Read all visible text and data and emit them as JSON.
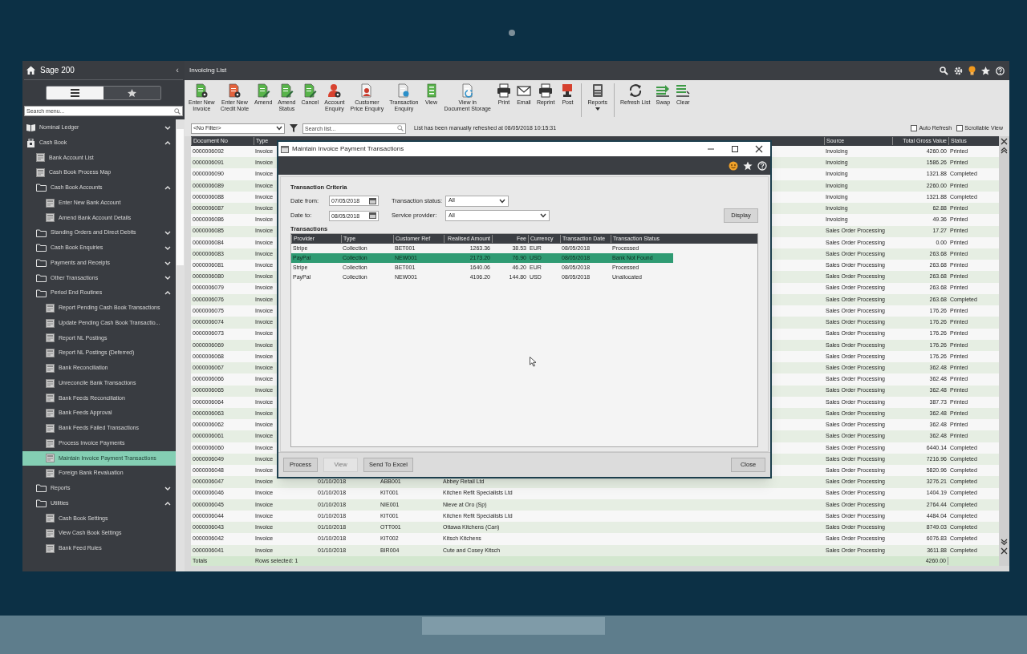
{
  "sidebar": {
    "title": "Sage 200",
    "collapse": "‹",
    "view_toggle": [
      {
        "kind": "list",
        "selected": true
      },
      {
        "kind": "favourites",
        "selected": false
      }
    ],
    "search": {
      "placeholder": "Search menu..."
    },
    "tree": [
      {
        "label": "Nominal Ledger",
        "kind": "module",
        "expanded": false,
        "selected": false
      },
      {
        "label": "Cash Book",
        "kind": "module",
        "expanded": true,
        "selected": false,
        "children": [
          {
            "label": "Bank Account List",
            "kind": "screen",
            "selected": false
          },
          {
            "label": "Cash Book Process Map",
            "kind": "screen",
            "selected": false
          },
          {
            "label": "Cash Book Accounts",
            "kind": "folder",
            "expanded": true,
            "selected": false,
            "children": [
              {
                "label": "Enter New Bank Account",
                "kind": "screen",
                "selected": false
              },
              {
                "label": "Amend Bank Account Details",
                "kind": "screen",
                "selected": false
              }
            ]
          },
          {
            "label": "Standing Orders and Direct Debits",
            "kind": "folder",
            "expanded": false,
            "selected": false
          },
          {
            "label": "Cash Book Enquiries",
            "kind": "folder",
            "expanded": false,
            "selected": false
          },
          {
            "label": "Payments and Receipts",
            "kind": "folder",
            "expanded": false,
            "selected": false
          },
          {
            "label": "Other Transactions",
            "kind": "folder",
            "expanded": false,
            "selected": false
          },
          {
            "label": "Period End Routines",
            "kind": "folder",
            "expanded": true,
            "selected": false,
            "children": [
              {
                "label": "Report Pending Cash Book Transactions",
                "kind": "screen",
                "selected": false
              },
              {
                "label": "Update Pending Cash Book Transactio...",
                "kind": "screen",
                "selected": false
              },
              {
                "label": "Report NL Postings",
                "kind": "screen",
                "selected": false
              },
              {
                "label": "Report NL Postings (Deferred)",
                "kind": "screen",
                "selected": false
              },
              {
                "label": "Bank Reconciliation",
                "kind": "screen",
                "selected": false
              },
              {
                "label": "Unreconcile Bank Transactions",
                "kind": "screen",
                "selected": false
              },
              {
                "label": "Bank Feeds Reconciliation",
                "kind": "screen",
                "selected": false
              },
              {
                "label": "Bank Feeds Approval",
                "kind": "screen",
                "selected": false
              },
              {
                "label": "Bank Feeds Failed Transactions",
                "kind": "screen",
                "selected": false
              },
              {
                "label": "Process Invoice Payments",
                "kind": "screen",
                "selected": false
              },
              {
                "label": "Maintain Invoice Payment Transactions",
                "kind": "screen",
                "selected": true
              },
              {
                "label": "Foreign Bank Revaluation",
                "kind": "screen",
                "selected": false
              }
            ]
          },
          {
            "label": "Reports",
            "kind": "folder",
            "expanded": false,
            "selected": false
          },
          {
            "label": "Utilities",
            "kind": "folder",
            "expanded": true,
            "selected": false,
            "children": [
              {
                "label": "Cash Book Settings",
                "kind": "screen",
                "selected": false
              },
              {
                "label": "View Cash Book Settings",
                "kind": "screen",
                "selected": false
              },
              {
                "label": "Bank Feed Rules",
                "kind": "screen",
                "selected": false
              }
            ]
          }
        ]
      }
    ]
  },
  "main": {
    "title": "Invoicing List",
    "toolbar": [
      {
        "label": "Enter New\nInvoice",
        "has_menu": false,
        "separator_before": false
      },
      {
        "label": "Enter New\nCredit Note",
        "has_menu": false,
        "separator_before": false
      },
      {
        "label": "Amend",
        "has_menu": false,
        "separator_before": false
      },
      {
        "label": "Amend\nStatus",
        "has_menu": false,
        "separator_before": false
      },
      {
        "label": "Cancel",
        "has_menu": false,
        "separator_before": false
      },
      {
        "label": "Account\nEnquiry",
        "has_menu": false,
        "separator_before": false
      },
      {
        "label": "Customer\nPrice Enquiry",
        "has_menu": false,
        "separator_before": false
      },
      {
        "label": "Transaction\nEnquiry",
        "has_menu": false,
        "separator_before": false
      },
      {
        "label": "View",
        "has_menu": false,
        "separator_before": false
      },
      {
        "label": "View in\nDocument Storage",
        "has_menu": false,
        "separator_before": false
      },
      {
        "label": "Print",
        "has_menu": false,
        "separator_before": false
      },
      {
        "label": "Email",
        "has_menu": false,
        "separator_before": false
      },
      {
        "label": "Reprint",
        "has_menu": false,
        "separator_before": false
      },
      {
        "label": "Post",
        "has_menu": false,
        "separator_before": false
      },
      {
        "label": "Reports",
        "has_menu": true,
        "separator_before": true
      },
      {
        "label": "Refresh List",
        "has_menu": false,
        "separator_before": true
      },
      {
        "label": "Swap",
        "has_menu": false,
        "separator_before": false
      },
      {
        "label": "Clear",
        "has_menu": false,
        "separator_before": false
      }
    ],
    "filter": {
      "value": "<No Filter>"
    },
    "search": {
      "placeholder": "Search list..."
    },
    "refresh_note": "List has been manually refreshed at 08/05/2018 10:15:31",
    "checkboxes": [
      {
        "label": "Auto Refresh",
        "checked": false
      },
      {
        "label": "Scrollable View",
        "checked": false
      }
    ],
    "grid": {
      "columns": {
        "document_no": "Document No",
        "type": "Type",
        "source": "Source",
        "total": "Total Gross Value",
        "status": "Status"
      },
      "rows": [
        {
          "document_no": "0000006092",
          "type": "Invoice",
          "source": "Invoicing",
          "total": "4260.00",
          "status": "Printed"
        },
        {
          "document_no": "0000006091",
          "type": "Invoice",
          "source": "Invoicing",
          "total": "1586.26",
          "status": "Printed"
        },
        {
          "document_no": "0000006090",
          "type": "Invoice",
          "source": "Invoicing",
          "total": "1321.88",
          "status": "Completed"
        },
        {
          "document_no": "0000006089",
          "type": "Invoice",
          "source": "Invoicing",
          "total": "2260.00",
          "status": "Printed"
        },
        {
          "document_no": "0000006088",
          "type": "Invoice",
          "source": "Invoicing",
          "total": "1321.88",
          "status": "Completed"
        },
        {
          "document_no": "0000006087",
          "type": "Invoice",
          "source": "Invoicing",
          "total": "62.88",
          "status": "Printed"
        },
        {
          "document_no": "0000006086",
          "type": "Invoice",
          "source": "Invoicing",
          "total": "49.36",
          "status": "Printed"
        },
        {
          "document_no": "0000006085",
          "type": "Invoice",
          "source": "Sales Order Processing",
          "total": "17.27",
          "status": "Printed"
        },
        {
          "document_no": "0000006084",
          "type": "Invoice",
          "source": "Sales Order Processing",
          "total": "0.00",
          "status": "Printed"
        },
        {
          "document_no": "0000006083",
          "type": "Invoice",
          "source": "Sales Order Processing",
          "total": "263.68",
          "status": "Printed"
        },
        {
          "document_no": "0000006081",
          "type": "Invoice",
          "source": "Sales Order Processing",
          "total": "263.68",
          "status": "Printed"
        },
        {
          "document_no": "0000006080",
          "type": "Invoice",
          "source": "Sales Order Processing",
          "total": "263.68",
          "status": "Printed"
        },
        {
          "document_no": "0000006079",
          "type": "Invoice",
          "source": "Sales Order Processing",
          "total": "263.68",
          "status": "Printed"
        },
        {
          "document_no": "0000006076",
          "type": "Invoice",
          "source": "Sales Order Processing",
          "total": "263.68",
          "status": "Completed"
        },
        {
          "document_no": "0000006075",
          "type": "Invoice",
          "source": "Sales Order Processing",
          "total": "176.26",
          "status": "Printed"
        },
        {
          "document_no": "0000006074",
          "type": "Invoice",
          "source": "Sales Order Processing",
          "total": "176.26",
          "status": "Printed"
        },
        {
          "document_no": "0000006073",
          "type": "Invoice",
          "source": "Sales Order Processing",
          "total": "176.26",
          "status": "Printed"
        },
        {
          "document_no": "0000006069",
          "type": "Invoice",
          "source": "Sales Order Processing",
          "total": "176.26",
          "status": "Printed"
        },
        {
          "document_no": "0000006068",
          "type": "Invoice",
          "source": "Sales Order Processing",
          "total": "176.26",
          "status": "Printed"
        },
        {
          "document_no": "0000006067",
          "type": "Invoice",
          "source": "Sales Order Processing",
          "total": "362.48",
          "status": "Printed"
        },
        {
          "document_no": "0000006066",
          "type": "Invoice",
          "source": "Sales Order Processing",
          "total": "362.48",
          "status": "Printed"
        },
        {
          "document_no": "0000006065",
          "type": "Invoice",
          "source": "Sales Order Processing",
          "total": "362.48",
          "status": "Printed"
        },
        {
          "document_no": "0000006064",
          "type": "Invoice",
          "source": "Sales Order Processing",
          "total": "387.73",
          "status": "Printed"
        },
        {
          "document_no": "0000006063",
          "type": "Invoice",
          "source": "Sales Order Processing",
          "total": "362.48",
          "status": "Printed"
        },
        {
          "document_no": "0000006062",
          "type": "Invoice",
          "source": "Sales Order Processing",
          "total": "362.48",
          "status": "Printed"
        },
        {
          "document_no": "0000006061",
          "type": "Invoice",
          "source": "Sales Order Processing",
          "total": "362.48",
          "status": "Printed"
        },
        {
          "document_no": "0000006060",
          "type": "Invoice",
          "source": "Sales Order Processing",
          "total": "6440.14",
          "status": "Completed"
        },
        {
          "document_no": "0000006049",
          "type": "Invoice",
          "source": "Sales Order Processing",
          "total": "7216.96",
          "status": "Completed"
        },
        {
          "document_no": "0000006048",
          "type": "Invoice",
          "source": "Sales Order Processing",
          "total": "5820.96",
          "status": "Completed"
        },
        {
          "document_no": "0000006047",
          "type": "Invoice",
          "date": "01/10/2018",
          "customer_ref": "ABB001",
          "name": "Abbey Retail Ltd",
          "source": "Sales Order Processing",
          "total": "3276.21",
          "status": "Completed"
        },
        {
          "document_no": "0000006046",
          "type": "Invoice",
          "date": "01/10/2018",
          "customer_ref": "KIT001",
          "name": "Kitchen Refit Specialists Ltd",
          "source": "Sales Order Processing",
          "total": "1404.19",
          "status": "Completed"
        },
        {
          "document_no": "0000006045",
          "type": "Invoice",
          "date": "01/10/2018",
          "customer_ref": "NIE001",
          "name": "Nieve at Oro (Sp)",
          "source": "Sales Order Processing",
          "total": "2764.44",
          "status": "Completed"
        },
        {
          "document_no": "0000006044",
          "type": "Invoice",
          "date": "01/10/2018",
          "customer_ref": "KIT001",
          "name": "Kitchen Refit Specialists Ltd",
          "source": "Sales Order Processing",
          "total": "4484.04",
          "status": "Completed"
        },
        {
          "document_no": "0000006043",
          "type": "Invoice",
          "date": "01/10/2018",
          "customer_ref": "OTT001",
          "name": "Ottawa Kitchens (Can)",
          "source": "Sales Order Processing",
          "total": "8749.03",
          "status": "Completed"
        },
        {
          "document_no": "0000006042",
          "type": "Invoice",
          "date": "01/10/2018",
          "customer_ref": "KIT002",
          "name": "Kitsch Kitchens",
          "source": "Sales Order Processing",
          "total": "6076.83",
          "status": "Completed"
        },
        {
          "document_no": "0000006041",
          "type": "Invoice",
          "date": "01/10/2018",
          "customer_ref": "BIR004",
          "name": "Cute and Cosey Kitsch",
          "source": "Sales Order Processing",
          "total": "3611.88",
          "status": "Completed"
        }
      ],
      "totals": {
        "label": "Totals",
        "rows_selected": "Rows selected: 1",
        "total": "4260.00"
      }
    }
  },
  "dialog": {
    "title": "Maintain Invoice Payment Transactions",
    "criteria_heading": "Transaction Criteria",
    "date_from": {
      "label": "Date from:",
      "value": "07/05/2018"
    },
    "transaction_status": {
      "label": "Transaction status:",
      "value": "All"
    },
    "date_to": {
      "label": "Date to:",
      "value": "08/05/2018"
    },
    "service_provider": {
      "label": "Service provider:",
      "value": "All"
    },
    "display_button": "Display",
    "transactions_heading": "Transactions",
    "columns": [
      "Provider",
      "Type",
      "Customer Ref",
      "Realised Amount",
      "Fee",
      "Currency",
      "Transaction Date",
      "Transaction Status"
    ],
    "rows": [
      {
        "provider": "Stripe",
        "type": "Collection",
        "customer_ref": "BET001",
        "realised_amount": "1263.36",
        "fee": "38.53",
        "currency": "EUR",
        "transaction_date": "08/05/2018",
        "status": "Processed",
        "selected": false
      },
      {
        "provider": "PayPal",
        "type": "Collection",
        "customer_ref": "NEW001",
        "realised_amount": "2173.20",
        "fee": "76.90",
        "currency": "USD",
        "transaction_date": "08/05/2018",
        "status": "Bank Not Found",
        "selected": true
      },
      {
        "provider": "Stripe",
        "type": "Collection",
        "customer_ref": "BET001",
        "realised_amount": "1640.06",
        "fee": "46.20",
        "currency": "EUR",
        "transaction_date": "08/05/2018",
        "status": "Processed",
        "selected": false
      },
      {
        "provider": "PayPal",
        "type": "Collection",
        "customer_ref": "NEW001",
        "realised_amount": "4106.20",
        "fee": "144.80",
        "currency": "USD",
        "transaction_date": "08/05/2018",
        "status": "Unallocated",
        "selected": false
      }
    ],
    "buttons": [
      {
        "label": "Process",
        "disabled": false
      },
      {
        "label": "View",
        "disabled": true
      },
      {
        "label": "Send To Excel",
        "disabled": false
      },
      {
        "label": "Close",
        "disabled": false
      }
    ]
  }
}
